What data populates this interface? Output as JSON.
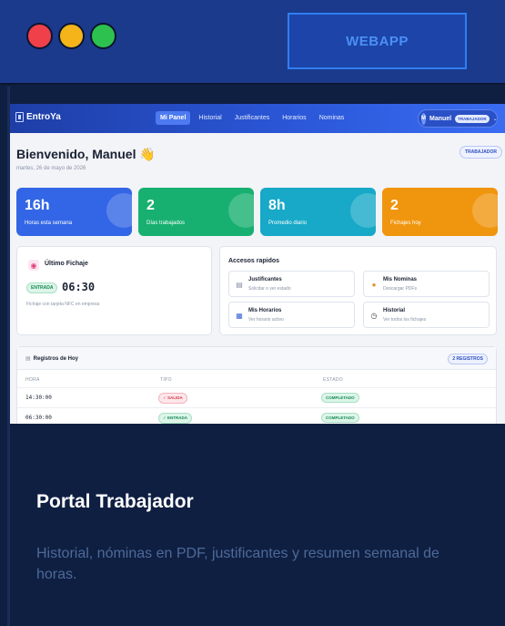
{
  "header": {
    "badge": "WEBAPP",
    "colors": {
      "red": "#f0404a",
      "yellow": "#f4b41a",
      "green": "#2dc24f"
    }
  },
  "app": {
    "brand": "EntroYa",
    "nav": [
      "Mi Panel",
      "Historial",
      "Justificantes",
      "Horarios",
      "Nominas"
    ],
    "user": {
      "initial": "M",
      "name": "Manuel",
      "role": "TRABAJADOR"
    },
    "welcome": "Bienvenido, Manuel",
    "wave": "👋",
    "date": "martes, 26 de mayo de 2026",
    "role_badge": "TRABAJADOR",
    "stats": [
      {
        "value": "16h",
        "label": "Horas esta semana"
      },
      {
        "value": "2",
        "label": "Días trabajados"
      },
      {
        "value": "8h",
        "label": "Promedio diario"
      },
      {
        "value": "2",
        "label": "Fichajes hoy"
      }
    ],
    "fichaje": {
      "title": "Último Fichaje",
      "type": "ENTRADA",
      "time": "06:30",
      "note": "Fichaje con tarjeta NFC en empresa"
    },
    "accesos": {
      "title": "Accesos rapidos",
      "items": [
        {
          "title": "Justificantes",
          "sub": "Solicitar o ver estado",
          "icon": "document-icon"
        },
        {
          "title": "Mis Nominas",
          "sub": "Descargar PDFs",
          "icon": "money-bag-icon"
        },
        {
          "title": "Mis Horarios",
          "sub": "Ver horario activo",
          "icon": "calendar-icon"
        },
        {
          "title": "Historial",
          "sub": "Ver todos los fichajes",
          "icon": "clock-icon"
        }
      ]
    },
    "registros": {
      "title": "Registros de Hoy",
      "count": "2 REGISTROS",
      "columns": [
        "HORA",
        "TIPO",
        "ESTADO"
      ],
      "rows": [
        {
          "time": "14:30:00",
          "type": "✓ SALIDA",
          "status": "COMPLETADO"
        },
        {
          "time": "06:30:00",
          "type": "✓ ENTRADA",
          "status": "COMPLETADO"
        }
      ]
    }
  },
  "portal": {
    "title": "Portal Trabajador",
    "description": "Historial, nóminas en PDF, justificantes y resumen semanal de horas."
  }
}
